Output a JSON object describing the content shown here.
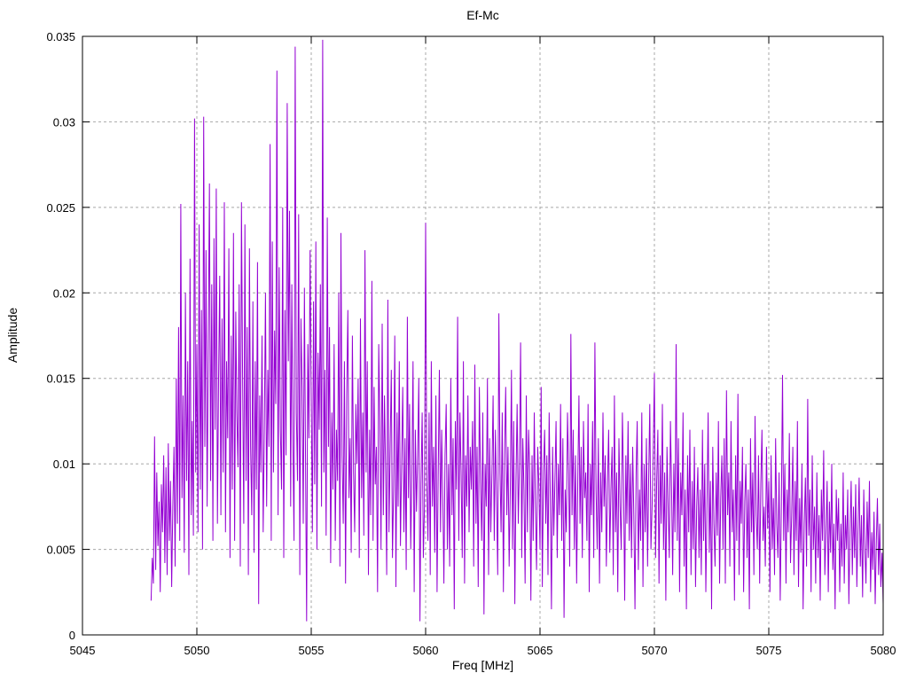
{
  "chart_data": {
    "type": "line",
    "title": "Ef-Mc",
    "xlabel": "Freq [MHz]",
    "ylabel": "Amplitude",
    "xlim": [
      5045,
      5080
    ],
    "ylim": [
      0,
      0.035
    ],
    "grid": true,
    "legend": "none",
    "line_color": "#9400d3",
    "grid_color": "#a8a8a8",
    "x_ticks": [
      5045,
      5050,
      5055,
      5060,
      5065,
      5070,
      5075,
      5080
    ],
    "x_tick_labels": [
      "5045",
      "5050",
      "5055",
      "5060",
      "5065",
      "5070",
      "5075",
      "5080"
    ],
    "y_ticks": [
      0,
      0.005,
      0.01,
      0.015,
      0.02,
      0.025,
      0.03,
      0.035
    ],
    "y_tick_labels": [
      "0",
      "0.005",
      "0.01",
      "0.015",
      "0.02",
      "0.025",
      "0.03",
      "0.035"
    ],
    "series": [
      {
        "name": "Ef-Mc",
        "x_start": 5048.0,
        "x_step": 0.05,
        "y_scale": 0.0001,
        "values": [
          20,
          45,
          30,
          116,
          38,
          95,
          52,
          78,
          25,
          88,
          60,
          105,
          42,
          98,
          35,
          112,
          55,
          90,
          28,
          75,
          110,
          40,
          150,
          65,
          180,
          55,
          252,
          80,
          140,
          48,
          200,
          90,
          160,
          35,
          220,
          70,
          125,
          58,
          302,
          95,
          170,
          60,
          240,
          85,
          190,
          50,
          303,
          110,
          225,
          75,
          170,
          264,
          90,
          205,
          55,
          232,
          120,
          261,
          65,
          150,
          210,
          70,
          185,
          95,
          253,
          60,
          160,
          115,
          226,
          45,
          175,
          85,
          235,
          55,
          189,
          130,
          98,
          205,
          40,
          253,
          150,
          65,
          240,
          90,
          180,
          35,
          226,
          110,
          70,
          195,
          48,
          160,
          85,
          218,
          18,
          140,
          95,
          175,
          60,
          120,
          200,
          75,
          155,
          110,
          287,
          55,
          230,
          95,
          178,
          135,
          330,
          70,
          215,
          120,
          85,
          250,
          45,
          190,
          105,
          311,
          160,
          248,
          75,
          205,
          110,
          55,
          344,
          130,
          90,
          246,
          35,
          185,
          145,
          65,
          203,
          100,
          8,
          170,
          115,
          225,
          140,
          60,
          195,
          88,
          230,
          50,
          165,
          120,
          205,
          75,
          348,
          95,
          155,
          58,
          244,
          110,
          180,
          42,
          130,
          85,
          170,
          55,
          120,
          90,
          200,
          40,
          235,
          105,
          65,
          160,
          30,
          140,
          190,
          80,
          115,
          48,
          175,
          95,
          60,
          135,
          100,
          150,
          45,
          185,
          80,
          130,
          58,
          225,
          95,
          160,
          35,
          120,
          70,
          207,
          55,
          145,
          88,
          110,
          25,
          170,
          125,
          50,
          182,
          70,
          140,
          95,
          35,
          196,
          60,
          110,
          155,
          45,
          85,
          175,
          28,
          130,
          75,
          160,
          52,
          100,
          145,
          60,
          115,
          38,
          186,
          80,
          135,
          50,
          95,
          160,
          25,
          120,
          72,
          105,
          150,
          8,
          88,
          130,
          45,
          75,
          241,
          90,
          55,
          130,
          35,
          160,
          75,
          110,
          48,
          140,
          25,
          95,
          155,
          60,
          120,
          80,
          30,
          105,
          135,
          50,
          100,
          40,
          150,
          70,
          115,
          15,
          125,
          85,
          186,
          55,
          130,
          95,
          45,
          160,
          30,
          105,
          75,
          140,
          60,
          110,
          85,
          125,
          40,
          158,
          65,
          110,
          28,
          145,
          90,
          55,
          130,
          12,
          100,
          75,
          150,
          35,
          115,
          60,
          95,
          140,
          55,
          120,
          80,
          35,
          188,
          95,
          60,
          130,
          25,
          105,
          145,
          70,
          110,
          40,
          85,
          155,
          50,
          125,
          18,
          90,
          135,
          65,
          100,
          171,
          45,
          115,
          85,
          30,
          140,
          60,
          120,
          95,
          20,
          105,
          55,
          130,
          75,
          38,
          110,
          88,
          50,
          145,
          28,
          95,
          120,
          65,
          105,
          35,
          130,
          80,
          15,
          110,
          58,
          90,
          125,
          45,
          100,
          70,
          135,
          55,
          115,
          10,
          85,
          60,
          130,
          95,
          40,
          176,
          70,
          120,
          50,
          105,
          30,
          90,
          140,
          65,
          110,
          45,
          125,
          80,
          95,
          55,
          135,
          25,
          100,
          70,
          125,
          45,
          171,
          85,
          50,
          115,
          30,
          95,
          60,
          130,
          75,
          105,
          40,
          88,
          120,
          48,
          85,
          110,
          35,
          140,
          60,
          95,
          25,
          115,
          75,
          50,
          130,
          90,
          20,
          105,
          65,
          125,
          55,
          100,
          45,
          110,
          70,
          15,
          95,
          125,
          38,
          85,
          55,
          130,
          28,
          100,
          60,
          115,
          40,
          90,
          135,
          50,
          75,
          108,
          153,
          45,
          90,
          120,
          30,
          105,
          65,
          135,
          50,
          95,
          20,
          110,
          75,
          45,
          125,
          85,
          35,
          100,
          60,
          170,
          55,
          115,
          25,
          95,
          70,
          130,
          40,
          85,
          15,
          105,
          60,
          120,
          35,
          90,
          50,
          110,
          28,
          75,
          98,
          45,
          85,
          35,
          120,
          55,
          100,
          25,
          75,
          130,
          48,
          90,
          15,
          110,
          65,
          40,
          95,
          58,
          125,
          30,
          80,
          105,
          50,
          115,
          30,
          143,
          70,
          95,
          40,
          125,
          60,
          85,
          20,
          105,
          55,
          141,
          35,
          90,
          65,
          110,
          25,
          78,
          100,
          45,
          85,
          15,
          115,
          60,
          95,
          35,
          128,
          70,
          50,
          105,
          30,
          88,
          120,
          55,
          75,
          40,
          110,
          62,
          90,
          25,
          105,
          50,
          80,
          35,
          115,
          65,
          45,
          95,
          20,
          75,
          152,
          55,
          100,
          30,
          85,
          60,
          118,
          42,
          70,
          110,
          35,
          90,
          55,
          125,
          28,
          80,
          48,
          100,
          15,
          65,
          92,
          40,
          138,
          58,
          85,
          25,
          105,
          50,
          75,
          30,
          95,
          45,
          70,
          20,
          85,
          55,
          108,
          35,
          60,
          90,
          25,
          78,
          48,
          100,
          38,
          65,
          15,
          85,
          55,
          80,
          25,
          65,
          40,
          95,
          30,
          70,
          50,
          85,
          18,
          60,
          90,
          35,
          75,
          45,
          88,
          28,
          62,
          92,
          40,
          70,
          22,
          85,
          50,
          30,
          78,
          45,
          90,
          25,
          60,
          38,
          72,
          18,
          55,
          80,
          35,
          65,
          28,
          48,
          18
        ]
      }
    ]
  }
}
